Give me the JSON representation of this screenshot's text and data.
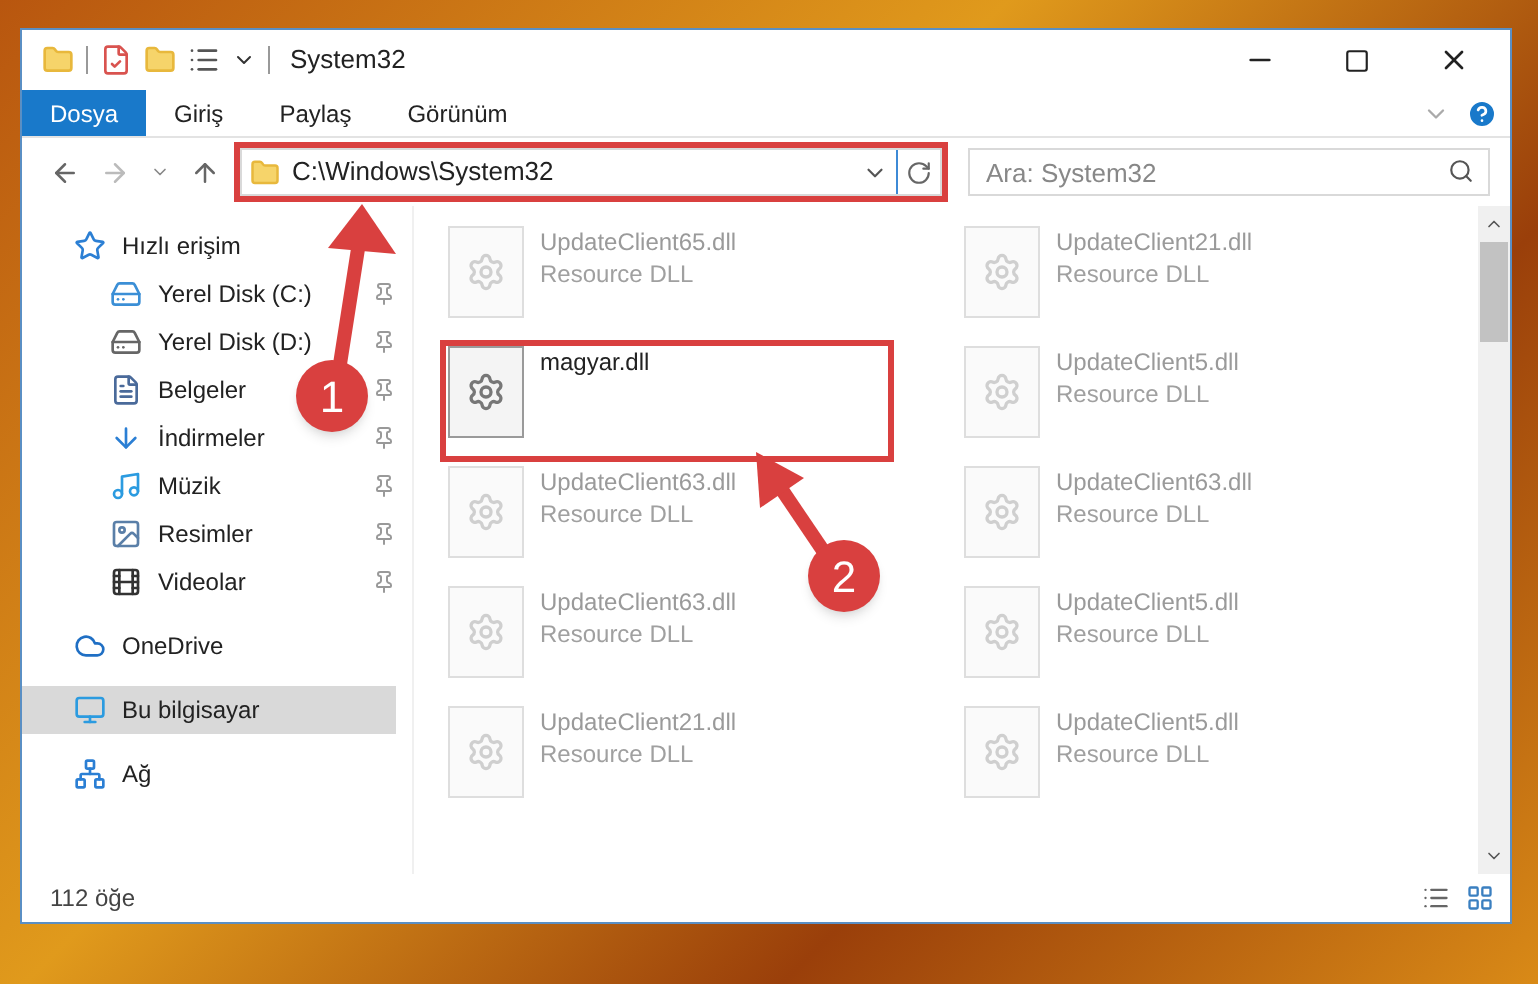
{
  "window": {
    "title": "System32"
  },
  "ribbon_tabs": [
    {
      "label": "Dosya",
      "selected": true
    },
    {
      "label": "Giriş",
      "selected": false
    },
    {
      "label": "Paylaş",
      "selected": false
    },
    {
      "label": "Görünüm",
      "selected": false
    }
  ],
  "address_bar": {
    "path": "C:\\Windows\\System32",
    "highlighted": true
  },
  "search": {
    "placeholder": "Ara: System32"
  },
  "sidebar": {
    "items": [
      {
        "label": "Hızlı erişim",
        "selected": false,
        "children": [
          {
            "label": "Yerel Disk (C:)",
            "pinned": true,
            "selected": false
          },
          {
            "label": "Yerel Disk (D:)",
            "pinned": true,
            "selected": false
          },
          {
            "label": "Belgeler",
            "pinned": true,
            "selected": false
          },
          {
            "label": "İndirmeler",
            "pinned": true,
            "selected": false
          },
          {
            "label": "Müzik",
            "pinned": true,
            "selected": false
          },
          {
            "label": "Resimler",
            "pinned": true,
            "selected": false
          },
          {
            "label": "Videolar",
            "pinned": true,
            "selected": false
          }
        ]
      },
      {
        "label": "OneDrive",
        "selected": false
      },
      {
        "label": "Bu bilgisayar",
        "selected": true
      },
      {
        "label": "Ağ",
        "selected": false
      }
    ]
  },
  "files": [
    {
      "name": "UpdateClient65.dll",
      "type": "Resource DLL",
      "dimmed": true,
      "highlighted": false
    },
    {
      "name": "UpdateClient21.dll",
      "type": "Resource DLL",
      "dimmed": true,
      "highlighted": false
    },
    {
      "name": "magyar.dll",
      "dimmed": false,
      "highlighted": true
    },
    {
      "name": "UpdateClient5.dll",
      "type": "Resource DLL",
      "dimmed": true,
      "highlighted": false
    },
    {
      "name": "UpdateClient63.dll",
      "type": "Resource DLL",
      "dimmed": true,
      "highlighted": false
    },
    {
      "name": "UpdateClient63.dll",
      "type": "Resource DLL",
      "dimmed": true,
      "highlighted": false
    },
    {
      "name": "UpdateClient63.dll",
      "type": "Resource DLL",
      "dimmed": true,
      "highlighted": false
    },
    {
      "name": "UpdateClient5.dll",
      "type": "Resource DLL",
      "dimmed": true,
      "highlighted": false
    },
    {
      "name": "UpdateClient21.dll",
      "type": "Resource DLL",
      "dimmed": true,
      "highlighted": false
    },
    {
      "name": "UpdateClient5.dll",
      "type": "Resource DLL",
      "dimmed": true,
      "highlighted": false
    }
  ],
  "status_bar": {
    "count": "112 öğe"
  },
  "annotations": [
    {
      "label": "1"
    },
    {
      "label": "2"
    }
  ]
}
